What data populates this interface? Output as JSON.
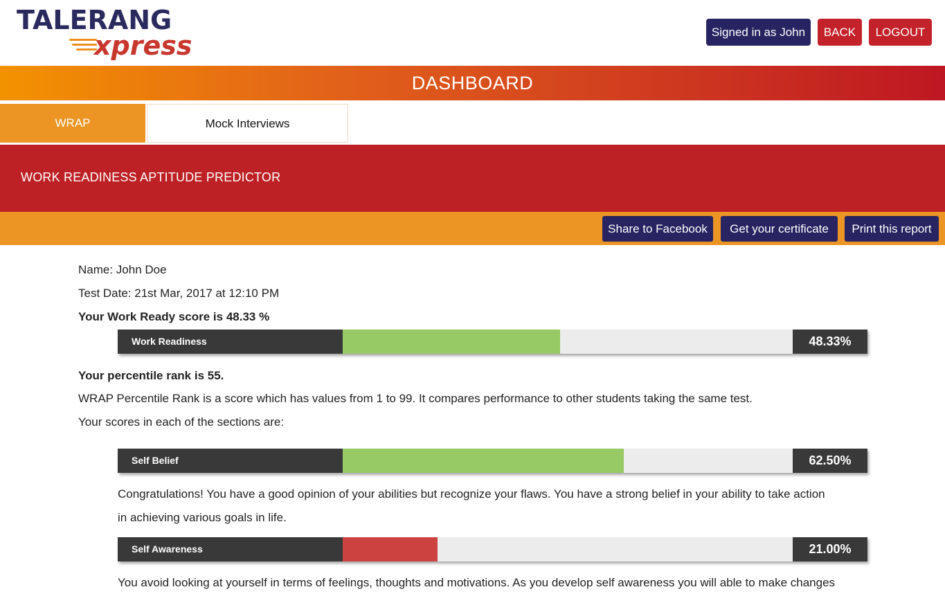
{
  "header": {
    "logo_top": "TALERANG",
    "logo_bottom": "xpress",
    "signed_in": "Signed in as John",
    "back": "BACK",
    "logout": "LOGOUT"
  },
  "dashboard_title": "DASHBOARD",
  "tabs": [
    {
      "label": "WRAP",
      "active": true
    },
    {
      "label": "Mock Interviews",
      "active": false
    }
  ],
  "banner_title": "WORK READINESS APTITUDE PREDICTOR",
  "actions": {
    "facebook": "Share to Facebook",
    "certificate": "Get your certificate",
    "print": "Print this report"
  },
  "report": {
    "name": "Name: John Doe",
    "test_date": "Test Date: 21st Mar, 2017 at 12:10 PM",
    "score_line": "Your Work Ready score is 48.33 %",
    "percentile_line": "Your percentile rank is 55.",
    "percentile_desc": "WRAP Percentile Rank is a score which has values from 1 to 99. It compares performance to other students taking the same test.",
    "sections_intro": "Your scores in each of the sections are:"
  },
  "bars": {
    "work_readiness": {
      "label": "Work Readiness",
      "pct_text": "48.33%",
      "value": 48.33,
      "color": "#97c965"
    },
    "self_belief": {
      "label": "Self Belief",
      "pct_text": "62.50%",
      "value": 62.5,
      "color": "#97c965"
    },
    "self_awareness": {
      "label": "Self Awareness",
      "pct_text": "21.00%",
      "value": 21.0,
      "color": "#cc4241"
    }
  },
  "feedback": {
    "self_belief_1": "Congratulations! You have a good opinion of your abilities but recognize your flaws. You have a strong belief in your ability to take action",
    "self_belief_2": "in achieving various goals in life.",
    "self_awareness_1": "You avoid looking at yourself in terms of feelings, thoughts and motivations. As you develop self awareness you will able to make changes"
  },
  "colors": {
    "brand_navy": "#272461",
    "brand_red": "#bd2125",
    "brand_orange": "#ec9525"
  }
}
